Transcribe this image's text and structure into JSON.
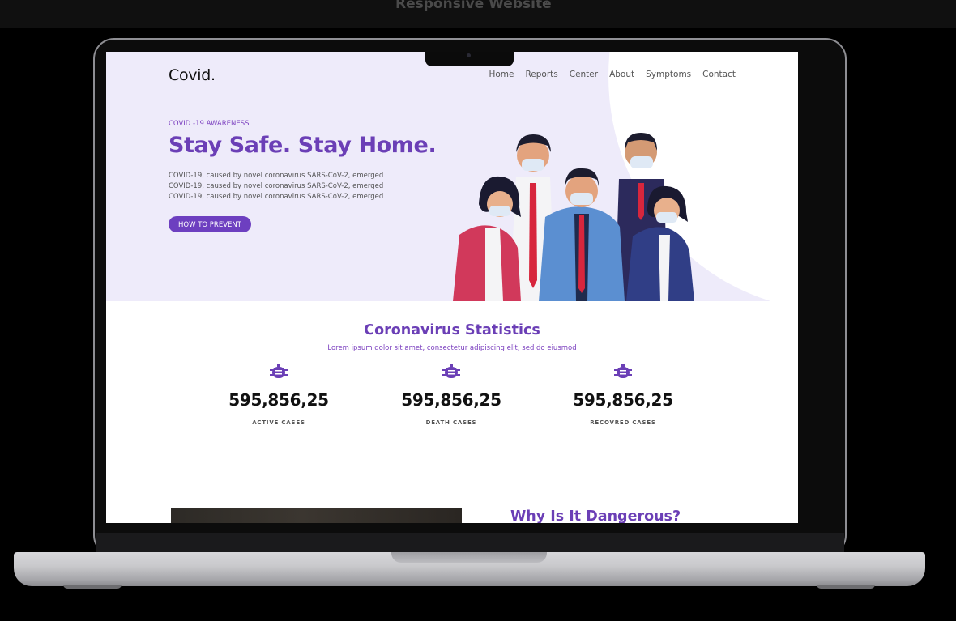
{
  "frame": {
    "title": "Responsive Website"
  },
  "site": {
    "logo": "Covid.",
    "nav": [
      "Home",
      "Reports",
      "Center",
      "About",
      "Symptoms",
      "Contact"
    ],
    "hero": {
      "eyebrow": "COVID -19 AWARENESS",
      "headline": "Stay Safe. Stay Home.",
      "desc_lines": [
        "COVID-19, caused by   novel coronavirus SARS-CoV-2, emerged",
        "COVID-19, caused by   novel coronavirus SARS-CoV-2, emerged",
        "COVID-19, caused by   novel coronavirus SARS-CoV-2, emerged"
      ],
      "cta": "HOW TO PREVENT"
    },
    "stats": {
      "title": "Coronavirus Statistics",
      "subtitle": "Lorem ipsum dolor sit amet, consectetur adipiscing elit, sed do eiusmod",
      "items": [
        {
          "value": "595,856,25",
          "label": "ACTIVE CASES",
          "icon": "virus-icon"
        },
        {
          "value": "595,856,25",
          "label": "DEATH CASES",
          "icon": "virus-icon"
        },
        {
          "value": "595,856,25",
          "label": "RECOVRED CASES",
          "icon": "virus-icon"
        }
      ]
    },
    "next_section": {
      "title": "Why Is It Dangerous?"
    }
  },
  "colors": {
    "accent": "#6b3fb6",
    "hero_bg": "#eeebfa",
    "button": "#6d3fc0"
  }
}
